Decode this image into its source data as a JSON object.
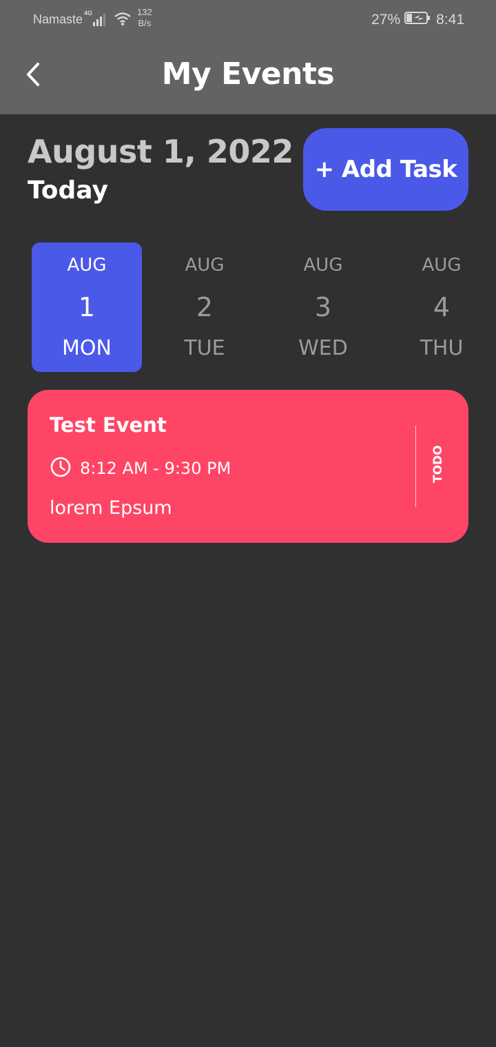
{
  "status_bar": {
    "carrier": "Namaste",
    "network_type": "4G",
    "speed_value": "132",
    "speed_unit": "B/s",
    "battery_percent": "27%",
    "time": "8:41"
  },
  "app_bar": {
    "title": "My Events",
    "back_icon": "chevron-left-icon"
  },
  "header": {
    "date": "August 1, 2022",
    "subtitle": "Today",
    "add_task_label": "+ Add Task"
  },
  "day_selector": [
    {
      "month": "AUG",
      "day": "1",
      "weekday": "MON",
      "selected": true
    },
    {
      "month": "AUG",
      "day": "2",
      "weekday": "TUE",
      "selected": false
    },
    {
      "month": "AUG",
      "day": "3",
      "weekday": "WED",
      "selected": false
    },
    {
      "month": "AUG",
      "day": "4",
      "weekday": "THU",
      "selected": false
    }
  ],
  "events": [
    {
      "title": "Test Event",
      "time": "8:12 AM - 9:30 PM",
      "description": "lorem Epsum",
      "status": "TODO",
      "icon": "clock-icon"
    }
  ],
  "colors": {
    "background": "#303030",
    "app_bar": "#636363",
    "accent": "#4b59e8",
    "event_card": "#ff4566",
    "muted_text": "#9b9b9b"
  }
}
